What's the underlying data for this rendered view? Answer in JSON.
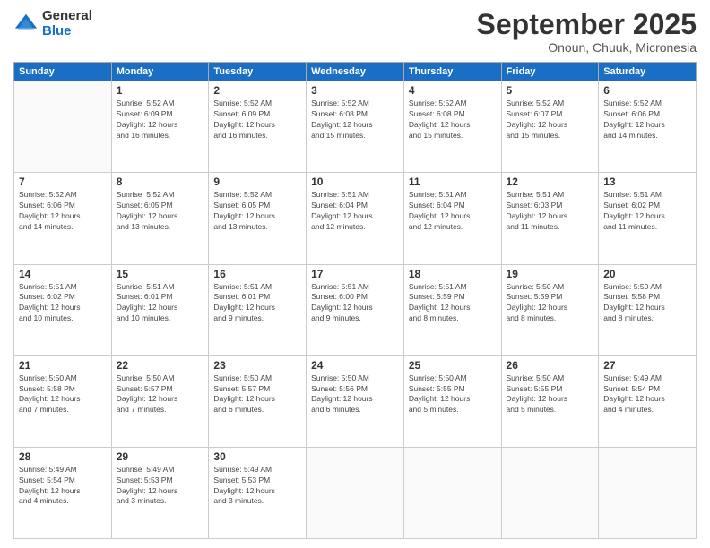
{
  "logo": {
    "general": "General",
    "blue": "Blue"
  },
  "header": {
    "month": "September 2025",
    "location": "Onoun, Chuuk, Micronesia"
  },
  "weekdays": [
    "Sunday",
    "Monday",
    "Tuesday",
    "Wednesday",
    "Thursday",
    "Friday",
    "Saturday"
  ],
  "weeks": [
    [
      {
        "day": "",
        "empty": true
      },
      {
        "day": "1",
        "sunrise": "5:52 AM",
        "sunset": "6:09 PM",
        "daylight": "12 hours and 16 minutes."
      },
      {
        "day": "2",
        "sunrise": "5:52 AM",
        "sunset": "6:09 PM",
        "daylight": "12 hours and 16 minutes."
      },
      {
        "day": "3",
        "sunrise": "5:52 AM",
        "sunset": "6:08 PM",
        "daylight": "12 hours and 15 minutes."
      },
      {
        "day": "4",
        "sunrise": "5:52 AM",
        "sunset": "6:08 PM",
        "daylight": "12 hours and 15 minutes."
      },
      {
        "day": "5",
        "sunrise": "5:52 AM",
        "sunset": "6:07 PM",
        "daylight": "12 hours and 15 minutes."
      },
      {
        "day": "6",
        "sunrise": "5:52 AM",
        "sunset": "6:06 PM",
        "daylight": "12 hours and 14 minutes."
      }
    ],
    [
      {
        "day": "7",
        "sunrise": "5:52 AM",
        "sunset": "6:06 PM",
        "daylight": "12 hours and 14 minutes."
      },
      {
        "day": "8",
        "sunrise": "5:52 AM",
        "sunset": "6:05 PM",
        "daylight": "12 hours and 13 minutes."
      },
      {
        "day": "9",
        "sunrise": "5:52 AM",
        "sunset": "6:05 PM",
        "daylight": "12 hours and 13 minutes."
      },
      {
        "day": "10",
        "sunrise": "5:51 AM",
        "sunset": "6:04 PM",
        "daylight": "12 hours and 12 minutes."
      },
      {
        "day": "11",
        "sunrise": "5:51 AM",
        "sunset": "6:04 PM",
        "daylight": "12 hours and 12 minutes."
      },
      {
        "day": "12",
        "sunrise": "5:51 AM",
        "sunset": "6:03 PM",
        "daylight": "12 hours and 11 minutes."
      },
      {
        "day": "13",
        "sunrise": "5:51 AM",
        "sunset": "6:02 PM",
        "daylight": "12 hours and 11 minutes."
      }
    ],
    [
      {
        "day": "14",
        "sunrise": "5:51 AM",
        "sunset": "6:02 PM",
        "daylight": "12 hours and 10 minutes."
      },
      {
        "day": "15",
        "sunrise": "5:51 AM",
        "sunset": "6:01 PM",
        "daylight": "12 hours and 10 minutes."
      },
      {
        "day": "16",
        "sunrise": "5:51 AM",
        "sunset": "6:01 PM",
        "daylight": "12 hours and 9 minutes."
      },
      {
        "day": "17",
        "sunrise": "5:51 AM",
        "sunset": "6:00 PM",
        "daylight": "12 hours and 9 minutes."
      },
      {
        "day": "18",
        "sunrise": "5:51 AM",
        "sunset": "5:59 PM",
        "daylight": "12 hours and 8 minutes."
      },
      {
        "day": "19",
        "sunrise": "5:50 AM",
        "sunset": "5:59 PM",
        "daylight": "12 hours and 8 minutes."
      },
      {
        "day": "20",
        "sunrise": "5:50 AM",
        "sunset": "5:58 PM",
        "daylight": "12 hours and 8 minutes."
      }
    ],
    [
      {
        "day": "21",
        "sunrise": "5:50 AM",
        "sunset": "5:58 PM",
        "daylight": "12 hours and 7 minutes."
      },
      {
        "day": "22",
        "sunrise": "5:50 AM",
        "sunset": "5:57 PM",
        "daylight": "12 hours and 7 minutes."
      },
      {
        "day": "23",
        "sunrise": "5:50 AM",
        "sunset": "5:57 PM",
        "daylight": "12 hours and 6 minutes."
      },
      {
        "day": "24",
        "sunrise": "5:50 AM",
        "sunset": "5:56 PM",
        "daylight": "12 hours and 6 minutes."
      },
      {
        "day": "25",
        "sunrise": "5:50 AM",
        "sunset": "5:55 PM",
        "daylight": "12 hours and 5 minutes."
      },
      {
        "day": "26",
        "sunrise": "5:50 AM",
        "sunset": "5:55 PM",
        "daylight": "12 hours and 5 minutes."
      },
      {
        "day": "27",
        "sunrise": "5:49 AM",
        "sunset": "5:54 PM",
        "daylight": "12 hours and 4 minutes."
      }
    ],
    [
      {
        "day": "28",
        "sunrise": "5:49 AM",
        "sunset": "5:54 PM",
        "daylight": "12 hours and 4 minutes."
      },
      {
        "day": "29",
        "sunrise": "5:49 AM",
        "sunset": "5:53 PM",
        "daylight": "12 hours and 3 minutes."
      },
      {
        "day": "30",
        "sunrise": "5:49 AM",
        "sunset": "5:53 PM",
        "daylight": "12 hours and 3 minutes."
      },
      {
        "day": "",
        "empty": true
      },
      {
        "day": "",
        "empty": true
      },
      {
        "day": "",
        "empty": true
      },
      {
        "day": "",
        "empty": true
      }
    ]
  ]
}
